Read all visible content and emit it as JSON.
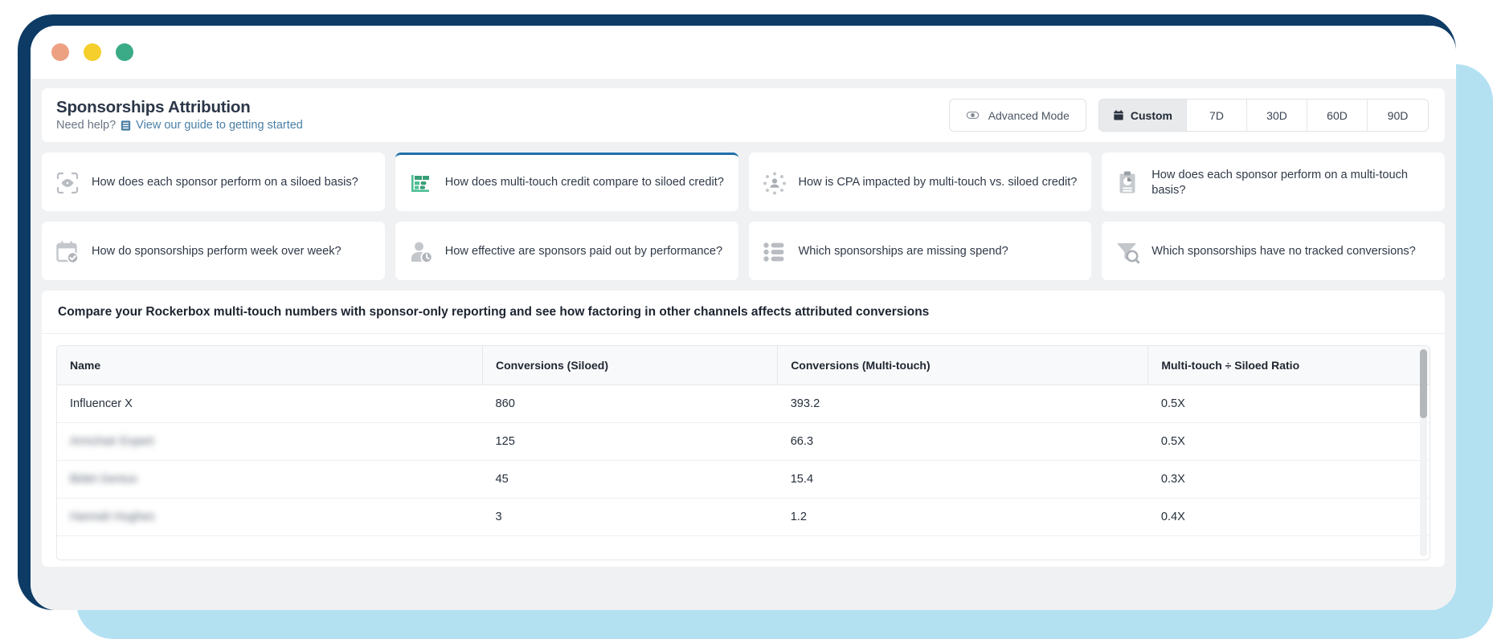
{
  "window": {
    "traffic_lights": [
      "close-red",
      "minimize-yellow",
      "maximize-green"
    ]
  },
  "header": {
    "title": "Sponsorships Attribution",
    "need_help_prefix": "Need help?",
    "guide_link": "View our guide to getting started",
    "advanced_mode_label": "Advanced Mode",
    "date_ranges": [
      {
        "label": "Custom",
        "icon": "calendar-icon",
        "active": true
      },
      {
        "label": "7D",
        "active": false
      },
      {
        "label": "30D",
        "active": false
      },
      {
        "label": "60D",
        "active": false
      },
      {
        "label": "90D",
        "active": false
      }
    ]
  },
  "cards": [
    {
      "text": "How does each sponsor perform on a siloed basis?",
      "icon": "eye-scan-icon",
      "selected": false
    },
    {
      "text": "How does multi-touch credit compare to siloed credit?",
      "icon": "bar-chart-icon",
      "selected": true
    },
    {
      "text": "How is CPA impacted by multi-touch vs. siloed credit?",
      "icon": "person-network-icon",
      "selected": false
    },
    {
      "text": "How does each sponsor perform on a multi-touch basis?",
      "icon": "clipboard-pie-icon",
      "selected": false
    },
    {
      "text": "How do sponsorships perform week over week?",
      "icon": "calendar-check-icon",
      "selected": false
    },
    {
      "text": "How effective are sponsors paid out by performance?",
      "icon": "person-clock-icon",
      "selected": false
    },
    {
      "text": "Which sponsorships are missing spend?",
      "icon": "list-icon",
      "selected": false
    },
    {
      "text": "Which sponsorships have no tracked conversions?",
      "icon": "filter-search-icon",
      "selected": false
    }
  ],
  "panel": {
    "title": "Compare your Rockerbox multi-touch numbers with sponsor-only reporting and see how factoring in other channels affects attributed conversions",
    "columns": [
      "Name",
      "Conversions (Siloed)",
      "Conversions (Multi-touch)",
      "Multi-touch ÷ Siloed Ratio"
    ],
    "rows": [
      {
        "name": "Influencer X",
        "redacted": false,
        "siloed": "860",
        "multitouch": "393.2",
        "ratio": "0.5X"
      },
      {
        "name": "Armchair Expert",
        "redacted": true,
        "siloed": "125",
        "multitouch": "66.3",
        "ratio": "0.5X"
      },
      {
        "name": "Bidet Genius",
        "redacted": true,
        "siloed": "45",
        "multitouch": "15.4",
        "ratio": "0.3X"
      },
      {
        "name": "Hannah Hughes",
        "redacted": true,
        "siloed": "3",
        "multitouch": "1.2",
        "ratio": "0.4X"
      }
    ]
  },
  "colors": {
    "frame_navy": "#0d3b66",
    "frame_blue": "#b3e1f2",
    "accent_selected": "#1f6fa8",
    "link": "#4a7fa5",
    "icon_green": "#4cbf94",
    "icon_grey": "#b9bdc2"
  }
}
